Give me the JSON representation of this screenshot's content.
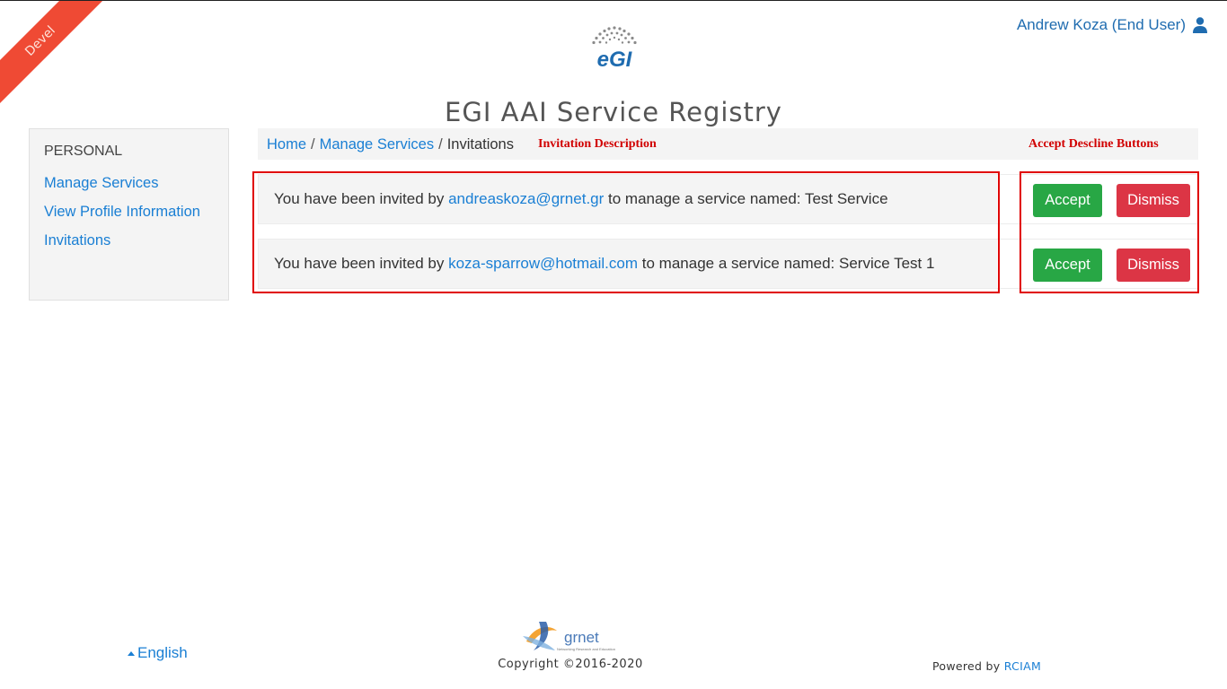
{
  "ribbon": {
    "label": "Devel",
    "color": "#ef4a34"
  },
  "user": {
    "name": "Andrew Koza (End User)",
    "icon": "user-icon"
  },
  "header": {
    "logo_text": "eGI",
    "title": "EGI AAI Service Registry"
  },
  "sidebar": {
    "heading": "PERSONAL",
    "items": [
      {
        "label": "Manage Services"
      },
      {
        "label": "View Profile Information"
      },
      {
        "label": "Invitations"
      }
    ]
  },
  "breadcrumb": {
    "items": [
      {
        "label": "Home"
      },
      {
        "label": "Manage Services"
      },
      {
        "label": "Invitations"
      }
    ],
    "separator": "/"
  },
  "annotations": {
    "description_label": "Invitation Description",
    "buttons_label": "Accept Descline Buttons",
    "color": "#e00000"
  },
  "invitations": [
    {
      "prefix": "You have been invited by",
      "email": "andreaskoza@grnet.gr",
      "suffix": "to manage a service named: Test Service",
      "accept_label": "Accept",
      "dismiss_label": "Dismiss"
    },
    {
      "prefix": "You have been invited by",
      "email": "koza-sparrow@hotmail.com",
      "suffix": "to manage a service named: Service Test 1",
      "accept_label": "Accept",
      "dismiss_label": "Dismiss"
    }
  ],
  "footer": {
    "language": "English",
    "grnet_name": "grnet",
    "grnet_tagline": "Networking Research and Education",
    "copyright": "Copyright ©2016-2020",
    "powered_prefix": "Powered by",
    "powered_link": "RCIAM"
  },
  "colors": {
    "accept": "#28a745",
    "dismiss": "#dc3545",
    "link": "#1a7fd4"
  }
}
